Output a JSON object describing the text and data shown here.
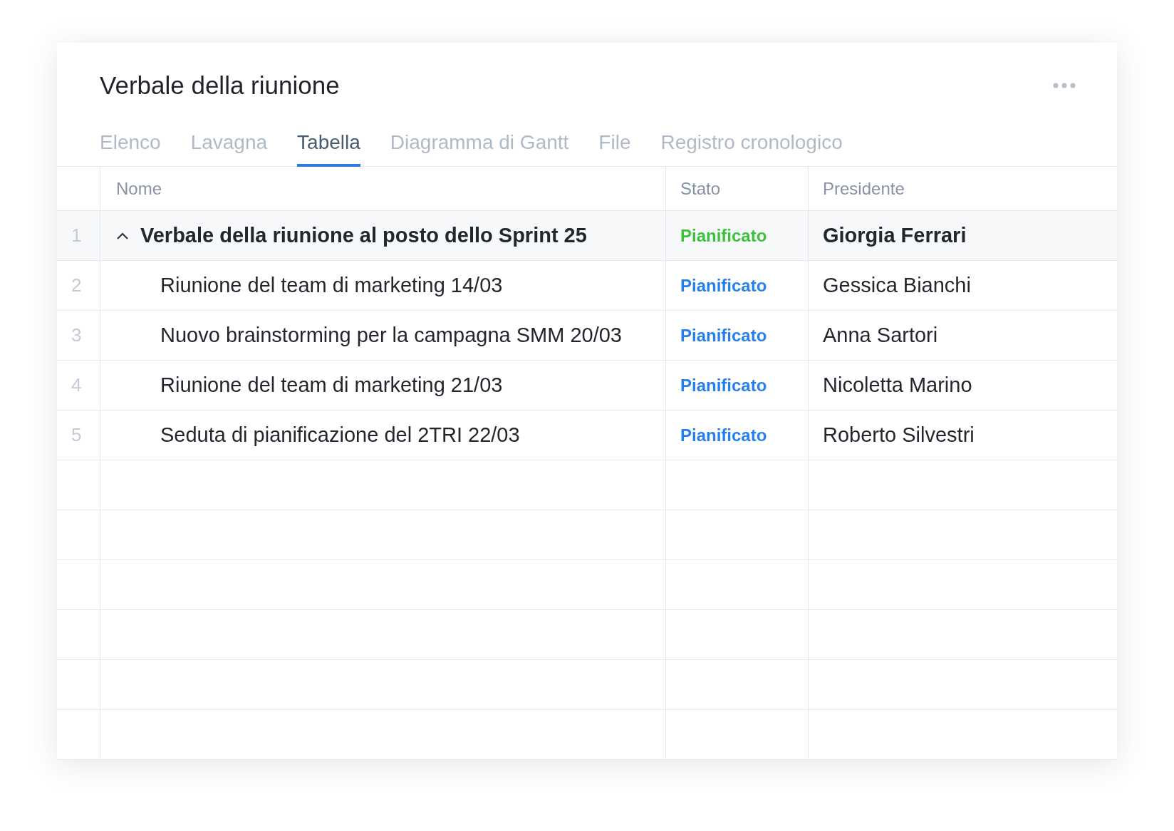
{
  "title": "Verbale della riunione",
  "tabs": [
    {
      "label": "Elenco",
      "selected": false
    },
    {
      "label": "Lavagna",
      "selected": false
    },
    {
      "label": "Tabella",
      "selected": true
    },
    {
      "label": "Diagramma di Gantt",
      "selected": false
    },
    {
      "label": "File",
      "selected": false
    },
    {
      "label": "Registro cronologico",
      "selected": false
    }
  ],
  "table": {
    "columns": [
      "Nome",
      "Stato",
      "Presidente"
    ],
    "rows": [
      {
        "number": "1",
        "name": "Verbale della riunione al posto dello Sprint 25",
        "status": "Pianificato",
        "color": "#3cc13b",
        "chair": "Giorgia Ferrari",
        "expanded": true,
        "children": [
          {
            "number": "2",
            "name": "Riunione del team di marketing 14/03",
            "status": "Pianificato",
            "color": "#2680eb",
            "chair": "Gessica Bianchi"
          },
          {
            "number": "3",
            "name": "Nuovo brainstorming per la campagna SMM 20/03",
            "status": "Pianificato",
            "color": "#2680eb",
            "chair": "Anna Sartori"
          },
          {
            "number": "4",
            "name": "Riunione del team di marketing 21/03",
            "status": "Pianificato",
            "color": "#2680eb",
            "chair": "Nicoletta Marino"
          },
          {
            "number": "5",
            "name": "Seduta di pianificazione del 2TRI 22/03",
            "status": "Pianificato",
            "color": "#2680eb",
            "chair": "Roberto Silvestri"
          }
        ]
      }
    ]
  }
}
